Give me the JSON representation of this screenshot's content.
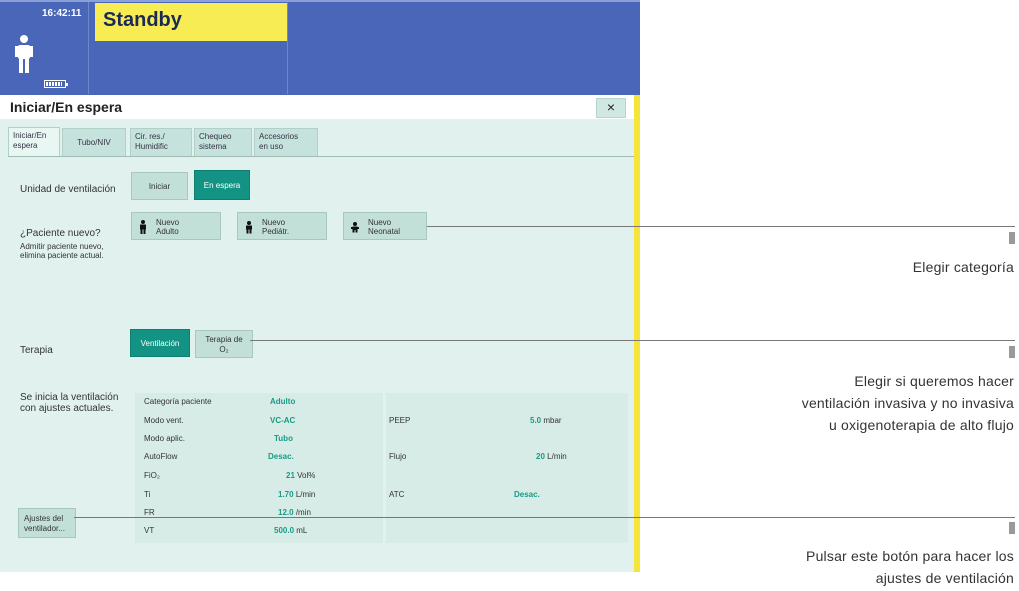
{
  "status_bar": {
    "time": "16:42:11",
    "mode": "Standby"
  },
  "dialog": {
    "title": "Iniciar/En espera",
    "close": "×"
  },
  "tabs": [
    {
      "l1": "Iniciar/En",
      "l2": "espera"
    },
    {
      "l1": "Tubo/NIV",
      "l2": ""
    },
    {
      "l1": "Cir. res./",
      "l2": "Humidific"
    },
    {
      "l1": "Chequeo",
      "l2": "sistema"
    },
    {
      "l1": "Accesorios",
      "l2": "en uso"
    }
  ],
  "unit": {
    "label": "Unidad de ventilación",
    "start": "Iniciar",
    "standby": "En espera"
  },
  "new_patient": {
    "label": "¿Paciente nuevo?",
    "note1": "Admitir paciente nuevo,",
    "note2": "elimina paciente actual.",
    "adult_l1": "Nuevo",
    "adult_l2": "Adulto",
    "ped_l1": "Nuevo",
    "ped_l2": "Pediátr.",
    "neo_l1": "Nuevo",
    "neo_l2": "Neonatal"
  },
  "therapy": {
    "label": "Terapia",
    "vent": "Ventilación",
    "o2_l1": "Terapia de",
    "o2_l2": "O₂"
  },
  "start_note": {
    "l1": "Se inicia la ventilación",
    "l2": "con ajustes actuales."
  },
  "params_left": [
    {
      "name": "Categoría paciente",
      "val": "Adulto",
      "unit": ""
    },
    {
      "name": "Modo vent.",
      "val": "VC-AC",
      "unit": ""
    },
    {
      "name": "Modo aplic.",
      "val": "Tubo",
      "unit": ""
    },
    {
      "name": "AutoFlow",
      "val": "Desac.",
      "unit": ""
    },
    {
      "name": "FiO₂",
      "val": "21",
      "unit": "Vol%"
    },
    {
      "name": "Ti",
      "val": "1.70",
      "unit": "L/min"
    },
    {
      "name": "FR",
      "val": "12.0",
      "unit": "/min"
    },
    {
      "name": "VT",
      "val": "500.0",
      "unit": "mL"
    }
  ],
  "params_right": [
    {
      "name": "PEEP",
      "val": "5.0",
      "unit": "mbar"
    },
    {
      "name": "Flujo",
      "val": "20",
      "unit": "L/min"
    },
    {
      "name": "ATC",
      "val": "Desac.",
      "unit": ""
    }
  ],
  "vent_settings": {
    "l1": "Ajustes del",
    "l2": "ventilador..."
  },
  "annotations": {
    "a1": "Elegir categoría",
    "a2_l1": "Elegir si queremos hacer",
    "a2_l2": "ventilación invasiva y no invasiva",
    "a2_l3": "u oxigenoterapia de alto flujo",
    "a3_l1": "Pulsar este botón para hacer los",
    "a3_l2": "ajustes de ventilación"
  },
  "colors": {
    "banner": "#4a66b8",
    "standby": "#f8ec55",
    "dialog_bg": "#e1f2ee",
    "accent": "#139383",
    "value": "#1a9a86"
  }
}
